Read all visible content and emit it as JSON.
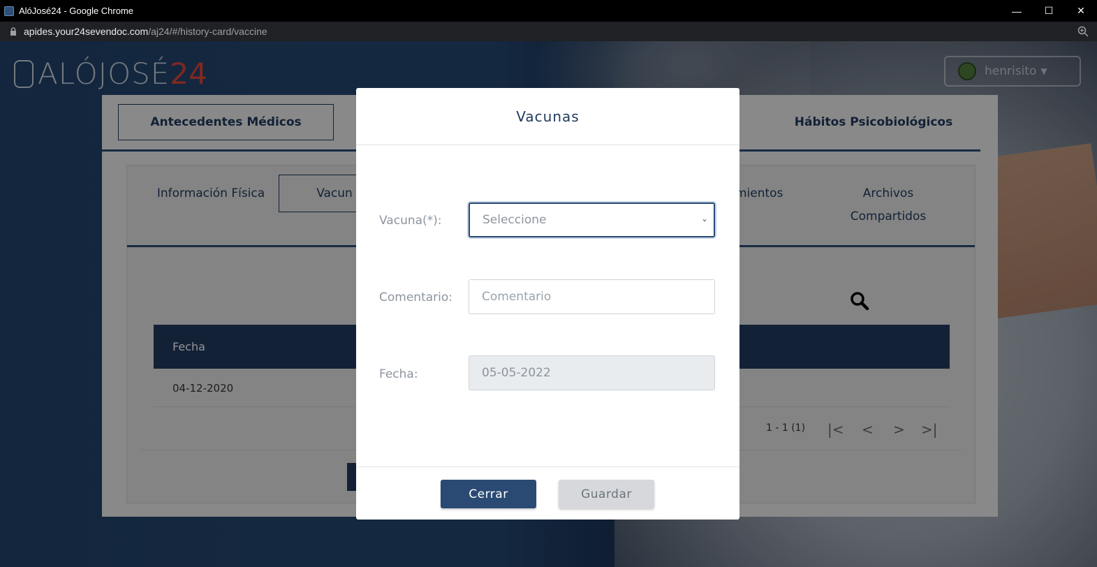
{
  "window": {
    "title": "AlóJosé24 - Google Chrome",
    "minimize": "—",
    "maximize": "☐",
    "close": "✕"
  },
  "address": {
    "host": "apides.your24sevendoc.com",
    "path": "/aj24/#/history-card/vaccine"
  },
  "brand": {
    "name": "ALÓJOSÉ",
    "number": "24"
  },
  "user": {
    "name": "henrisito"
  },
  "card": {
    "top_tabs": [
      "Antecedentes Médicos",
      "Hábitos Psicobiológicos"
    ],
    "sub_tabs": {
      "info": "Información Física",
      "vaccines": "Vacun",
      "treatments": "amientos",
      "files": "Archivos Compartidos"
    },
    "table": {
      "header": "Fecha",
      "rows": [
        {
          "fecha": "04-12-2020"
        }
      ]
    },
    "pager": {
      "range": "1 - 1 (1)",
      "first": "|<",
      "prev": "<",
      "next": ">",
      "last": ">|"
    }
  },
  "modal": {
    "title": "Vacunas",
    "vaccine_label": "Vacuna(*):",
    "vaccine_value": "Seleccione",
    "comment_label": "Comentario:",
    "comment_placeholder": "Comentario",
    "date_label": "Fecha:",
    "date_value": "05-05-2022",
    "close_label": "Cerrar",
    "save_label": "Guardar"
  },
  "colors": {
    "primary": "#2a4a73",
    "accent": "#d9453b"
  }
}
